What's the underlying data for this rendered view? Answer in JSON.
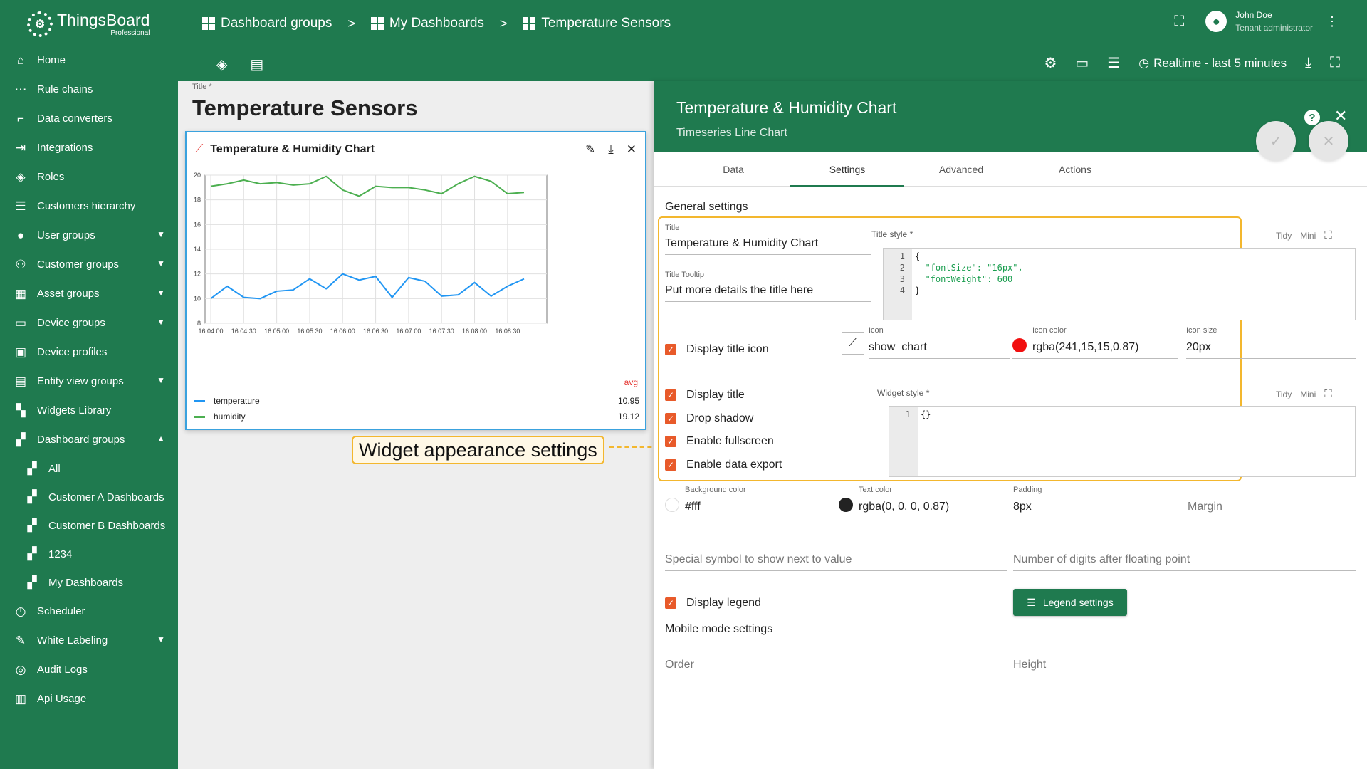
{
  "brand": {
    "name": "ThingsBoard",
    "edition": "Professional"
  },
  "sidebar": {
    "items": [
      {
        "label": "Home",
        "icon": "home-icon",
        "glyph": "⌂"
      },
      {
        "label": "Rule chains",
        "icon": "rule-chain-icon",
        "glyph": "⋯"
      },
      {
        "label": "Data converters",
        "icon": "converter-icon",
        "glyph": "⌐"
      },
      {
        "label": "Integrations",
        "icon": "integration-icon",
        "glyph": "⇥"
      },
      {
        "label": "Roles",
        "icon": "shield-icon",
        "glyph": "◈"
      },
      {
        "label": "Customers hierarchy",
        "icon": "hierarchy-icon",
        "glyph": "☰"
      },
      {
        "label": "User groups",
        "icon": "user-icon",
        "glyph": "●",
        "chevron": "▼"
      },
      {
        "label": "Customer groups",
        "icon": "customers-icon",
        "glyph": "⚇",
        "chevron": "▼"
      },
      {
        "label": "Asset groups",
        "icon": "asset-icon",
        "glyph": "▦",
        "chevron": "▼"
      },
      {
        "label": "Device groups",
        "icon": "device-icon",
        "glyph": "▭",
        "chevron": "▼"
      },
      {
        "label": "Device profiles",
        "icon": "device-profile-icon",
        "glyph": "▣"
      },
      {
        "label": "Entity view groups",
        "icon": "entity-view-icon",
        "glyph": "▤",
        "chevron": "▼"
      },
      {
        "label": "Widgets Library",
        "icon": "widgets-icon",
        "glyph": "▚"
      },
      {
        "label": "Dashboard groups",
        "icon": "dashboard-icon",
        "glyph": "▞",
        "chevron": "▲"
      },
      {
        "label": "All",
        "icon": "dashboard-icon",
        "glyph": "▞",
        "sub": true
      },
      {
        "label": "Customer A Dashboards",
        "icon": "dashboard-icon",
        "glyph": "▞",
        "sub": true
      },
      {
        "label": "Customer B Dashboards",
        "icon": "dashboard-icon",
        "glyph": "▞",
        "sub": true
      },
      {
        "label": "1234",
        "icon": "dashboard-icon",
        "glyph": "▞",
        "sub": true
      },
      {
        "label": "My Dashboards",
        "icon": "dashboard-icon",
        "glyph": "▞",
        "sub": true
      },
      {
        "label": "Scheduler",
        "icon": "clock-icon",
        "glyph": "◷"
      },
      {
        "label": "White Labeling",
        "icon": "paint-icon",
        "glyph": "✎",
        "chevron": "▼"
      },
      {
        "label": "Audit Logs",
        "icon": "audit-icon",
        "glyph": "◎"
      },
      {
        "label": "Api Usage",
        "icon": "chart-icon",
        "glyph": "▥"
      }
    ]
  },
  "breadcrumb": [
    "Dashboard groups",
    "My Dashboards",
    "Temperature Sensors"
  ],
  "breadcrumb_sep": ">",
  "user": {
    "name": "John Doe",
    "role": "Tenant administrator"
  },
  "toolbar": {
    "realtime_label": "Realtime - last 5 minutes"
  },
  "dashboard": {
    "title_label": "Title *",
    "title": "Temperature Sensors"
  },
  "widget": {
    "title": "Temperature & Humidity Chart",
    "legend_header": "avg",
    "legend": [
      {
        "name": "temperature",
        "value": "10.95",
        "color": "#2196f3"
      },
      {
        "name": "humidity",
        "value": "19.12",
        "color": "#4caf50"
      }
    ]
  },
  "chart_data": {
    "type": "line",
    "x": [
      "16:04:00",
      "16:04:15",
      "16:04:30",
      "16:04:45",
      "16:05:00",
      "16:05:15",
      "16:05:30",
      "16:05:45",
      "16:06:00",
      "16:06:15",
      "16:06:30",
      "16:06:45",
      "16:07:00",
      "16:07:15",
      "16:07:30",
      "16:07:45",
      "16:08:00",
      "16:08:15",
      "16:08:30",
      "16:08:45"
    ],
    "xticks": [
      "16:04:00",
      "16:04:30",
      "16:05:00",
      "16:05:30",
      "16:06:00",
      "16:06:30",
      "16:07:00",
      "16:07:30",
      "16:08:00",
      "16:08:30"
    ],
    "yticks": [
      8,
      10,
      12,
      14,
      16,
      18,
      20
    ],
    "ylim": [
      8,
      20
    ],
    "grid": true,
    "series": [
      {
        "name": "temperature",
        "color": "#2196f3",
        "values": [
          10.0,
          11.0,
          10.1,
          10.0,
          10.6,
          10.7,
          11.6,
          10.8,
          12.0,
          11.5,
          11.8,
          10.1,
          11.7,
          11.4,
          10.2,
          10.3,
          11.3,
          10.2,
          11.0,
          11.6
        ]
      },
      {
        "name": "humidity",
        "color": "#4caf50",
        "values": [
          19.1,
          19.3,
          19.6,
          19.3,
          19.4,
          19.2,
          19.3,
          19.9,
          18.8,
          18.3,
          19.1,
          19.0,
          19.0,
          18.8,
          18.5,
          19.3,
          19.9,
          19.5,
          18.5,
          18.6
        ]
      }
    ]
  },
  "panel": {
    "title": "Temperature & Humidity Chart",
    "subtitle": "Timeseries Line Chart",
    "tabs": [
      "Data",
      "Settings",
      "Advanced",
      "Actions"
    ],
    "general_settings": "General settings",
    "callout": "Widget appearance settings",
    "title_field": {
      "label": "Title",
      "value": "Temperature & Humidity Chart"
    },
    "tooltip_field": {
      "label": "Title Tooltip",
      "value": "Put more details the title here"
    },
    "title_style": {
      "label": "Title style *",
      "lines": [
        "{",
        "  \"fontSize\": \"16px\",",
        "  \"fontWeight\": 600",
        "}"
      ]
    },
    "widget_style": {
      "label": "Widget style *",
      "lines": [
        "{}"
      ]
    },
    "tidy": "Tidy",
    "mini": "Mini",
    "display_title_icon": "Display title icon",
    "icon": {
      "label": "Icon",
      "value": "show_chart"
    },
    "icon_color": {
      "label": "Icon color",
      "value": "rgba(241,15,15,0.87)",
      "swatch": "#f10f0f"
    },
    "icon_size": {
      "label": "Icon size",
      "value": "20px"
    },
    "display_title": "Display title",
    "drop_shadow": "Drop shadow",
    "enable_fullscreen": "Enable fullscreen",
    "enable_export": "Enable data export",
    "bg_color": {
      "label": "Background color",
      "value": "#fff",
      "swatch": "#ffffff"
    },
    "text_color": {
      "label": "Text color",
      "value": "rgba(0, 0, 0, 0.87)",
      "swatch": "#222222"
    },
    "padding": {
      "label": "Padding",
      "value": "8px"
    },
    "margin": {
      "placeholder": "Margin"
    },
    "special_symbol": {
      "placeholder": "Special symbol to show next to value"
    },
    "digits": {
      "placeholder": "Number of digits after floating point"
    },
    "display_legend": "Display legend",
    "legend_settings": "Legend settings",
    "mobile_mode": "Mobile mode settings",
    "order": {
      "placeholder": "Order"
    },
    "height": {
      "placeholder": "Height"
    }
  }
}
